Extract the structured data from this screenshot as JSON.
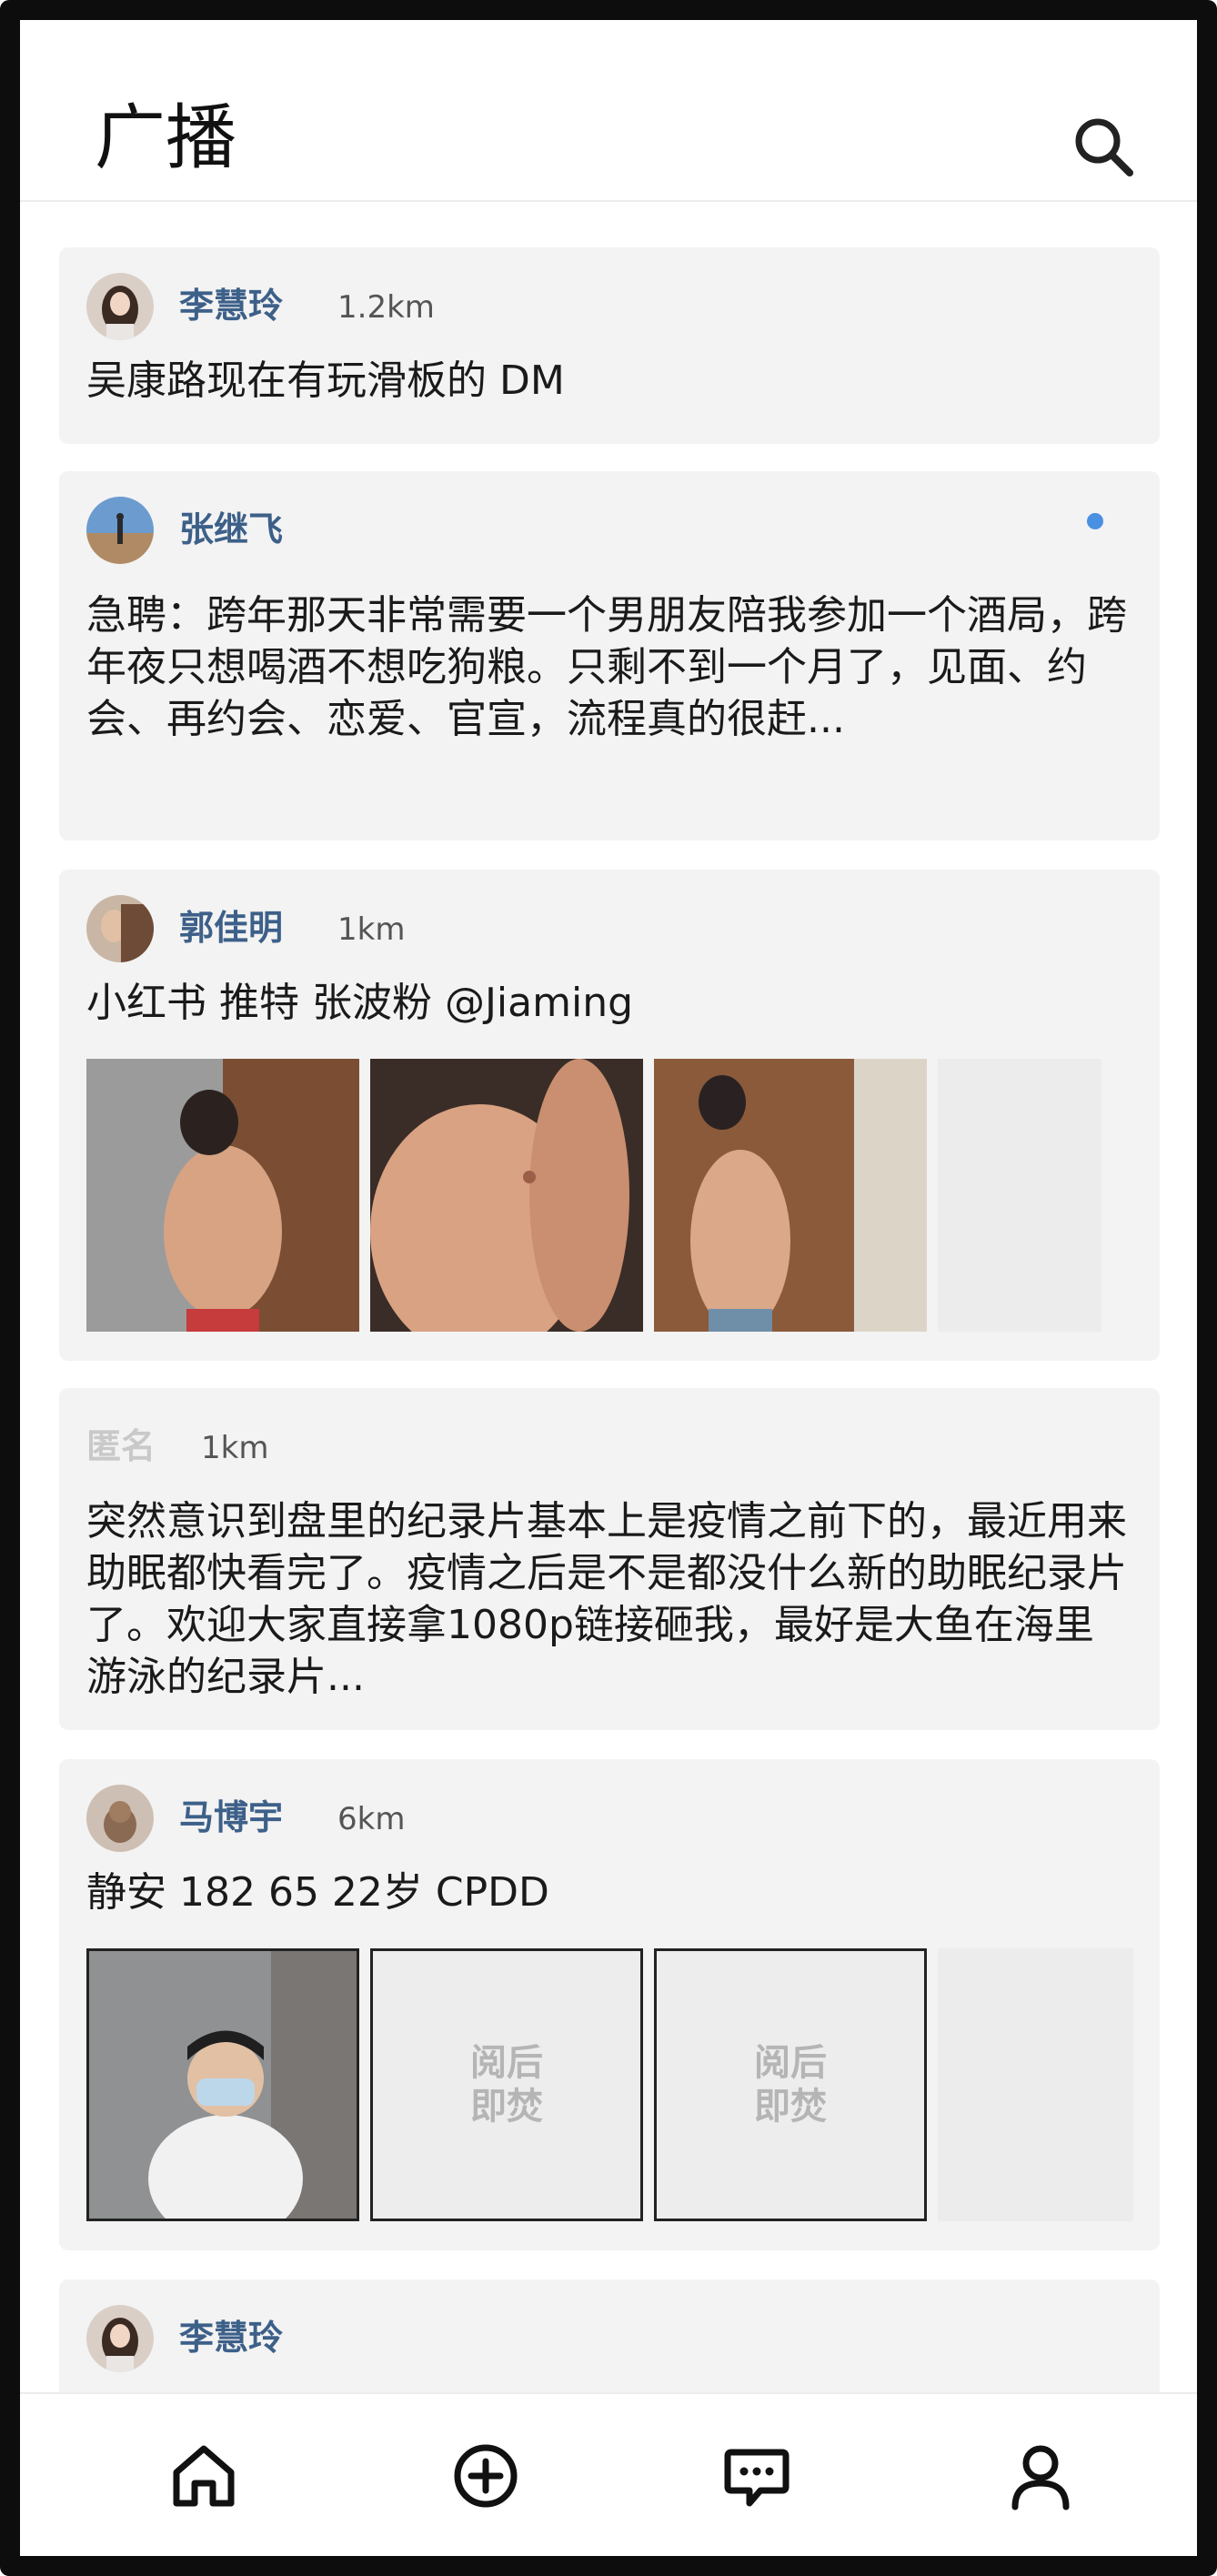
{
  "header": {
    "title": "广播",
    "search_icon": "search-icon"
  },
  "posts": [
    {
      "name": "李慧玲",
      "distance": "1.2km",
      "text": "吴康路现在有玩滑板的 DM"
    },
    {
      "name": "张继飞",
      "distance": "",
      "text": "急聘：跨年那天非常需要一个男朋友陪我参加一个酒局，跨年夜只想喝酒不想吃狗粮。只剩不到一个月了，见面、约会、再约会、恋爱、官宣，流程真的很赶..."
    },
    {
      "name": "郭佳明",
      "distance": "1km",
      "text": "小红书 推特 张波粉 @Jiaming"
    },
    {
      "name": "匿名",
      "distance": "1km",
      "text": "突然意识到盘里的纪录片基本上是疫情之前下的，最近用来助眠都快看完了。疫情之后是不是都没什么新的助眠纪录片了。欢迎大家直接拿1080p链接砸我，最好是大鱼在海里游泳的纪录片..."
    },
    {
      "name": "马博宇",
      "distance": "6km",
      "text": "静安 182 65 22岁 CPDD",
      "burn_label": "阅后即焚"
    },
    {
      "name": "李慧玲",
      "distance": "",
      "text": ""
    }
  ],
  "tabbar": {
    "items": [
      "home-icon",
      "add-post-icon",
      "messages-icon",
      "profile-icon"
    ]
  },
  "colors": {
    "name": "#3d6089",
    "card": "#f3f3f3",
    "unread_dot": "#4a90e2"
  }
}
